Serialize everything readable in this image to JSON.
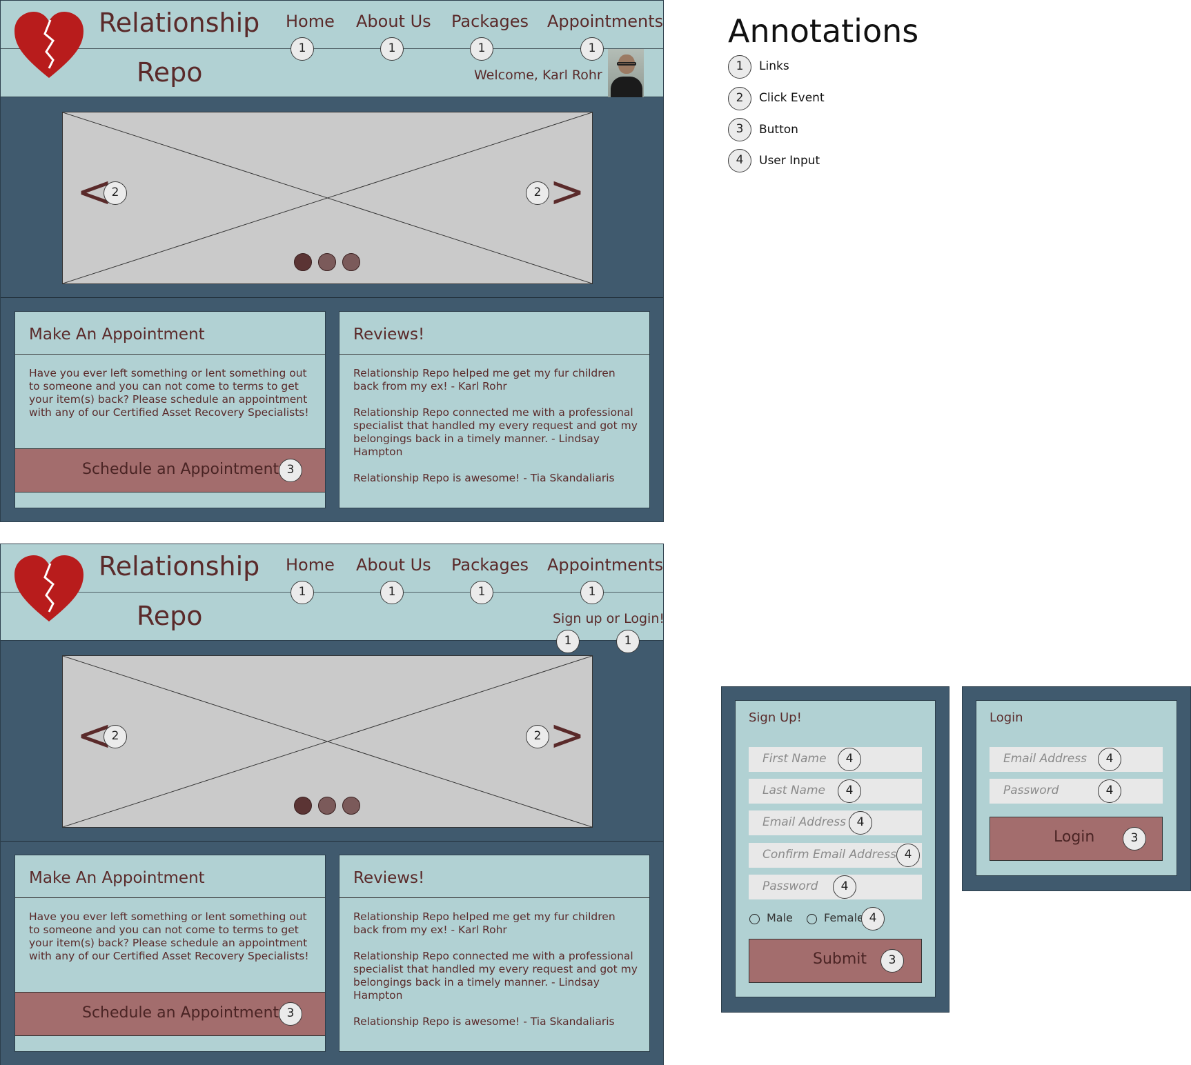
{
  "brand": {
    "line1": "Relationship",
    "line2": "Repo"
  },
  "nav": [
    {
      "label": "Home",
      "badge": "1"
    },
    {
      "label": "About Us",
      "badge": "1"
    },
    {
      "label": "Packages",
      "badge": "1"
    },
    {
      "label": "Appointments",
      "badge": "1"
    }
  ],
  "mockup_logged_in": {
    "welcome": "Welcome, Karl Rohr"
  },
  "mockup_logged_out": {
    "auth_link": "Sign up or Login!",
    "auth_badges": [
      "1",
      "1"
    ]
  },
  "carousel": {
    "prev_arrow": "<",
    "next_arrow": ">",
    "prev_badge": "2",
    "next_badge": "2",
    "dots_total": 3,
    "dots_active": 1
  },
  "appointment_card": {
    "title": "Make An Appointment",
    "body": "Have you ever left something or lent something out to someone and you can not come to terms to get your item(s) back? Please schedule an appointment with any of our Certified Asset Recovery Specialists!",
    "button": "Schedule an Appointment",
    "button_badge": "3"
  },
  "reviews_card": {
    "title": "Reviews!",
    "items": [
      "Relationship Repo helped me get my fur children back from my ex! - Karl Rohr",
      "Relationship Repo connected me with a professional specialist that handled my every request and got my belongings back in a timely manner. - Lindsay Hampton",
      "Relationship Repo is awesome! - Tia Skandaliaris"
    ]
  },
  "annotations": {
    "title": "Annotations",
    "items": [
      {
        "num": "1",
        "label": "Links"
      },
      {
        "num": "2",
        "label": "Click Event"
      },
      {
        "num": "3",
        "label": "Button"
      },
      {
        "num": "4",
        "label": "User Input"
      }
    ]
  },
  "signup_form": {
    "title": "Sign Up!",
    "fields": [
      {
        "placeholder": "First Name",
        "badge": "4"
      },
      {
        "placeholder": "Last Name",
        "badge": "4"
      },
      {
        "placeholder": "Email Address",
        "badge": "4"
      },
      {
        "placeholder": "Confirm Email Address",
        "badge": "4"
      },
      {
        "placeholder": "Password",
        "badge": "4"
      }
    ],
    "gender_options": [
      "Male",
      "Female"
    ],
    "gender_badge": "4",
    "submit": "Submit",
    "submit_badge": "3"
  },
  "login_form": {
    "title": "Login",
    "fields": [
      {
        "placeholder": "Email Address",
        "badge": "4"
      },
      {
        "placeholder": "Password",
        "badge": "4"
      }
    ],
    "submit": "Login",
    "submit_badge": "3"
  },
  "colors": {
    "header_bg": "#b1d1d3",
    "page_bg": "#405a6e",
    "button_bg": "#a36d6d",
    "text": "#5a2a2a",
    "logo_red": "#b81c1c",
    "dot_active": "#5b3434",
    "dot_inactive": "#7b5a5a"
  }
}
